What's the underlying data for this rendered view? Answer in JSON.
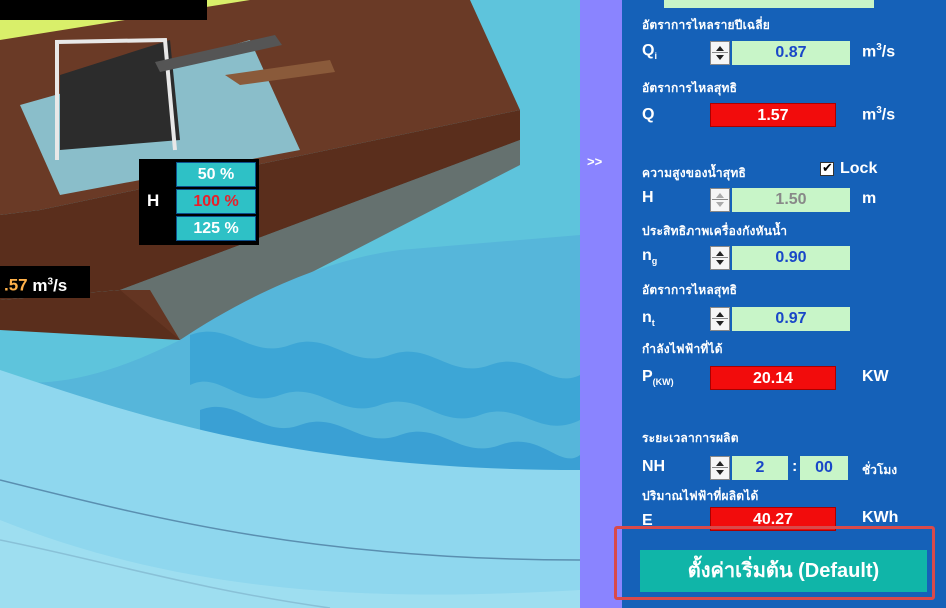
{
  "overlay": {
    "h_label": "H",
    "pct_options": [
      "50 %",
      "100 %",
      "125 %"
    ],
    "pct_selected": "100 %",
    "flow_value": ".57",
    "flow_unit": "m",
    "flow_unit_sup": "3",
    "flow_unit_tail": "/s"
  },
  "splitter": {
    "label": ">>"
  },
  "panel": {
    "avg_flow": {
      "title": "อัตราการไหลรายปีเฉลี่ย",
      "symbol": "Q",
      "sub": "i",
      "value": "0.87",
      "unit": "m",
      "unit_sup": "3",
      "unit_tail": "/s"
    },
    "net_flow": {
      "title": "อัตราการไหลสุทธิ",
      "symbol": "Q",
      "value": "1.57",
      "unit": "m",
      "unit_sup": "3",
      "unit_tail": "/s"
    },
    "net_head": {
      "title": "ความสูงของน้ำสุทธิ",
      "lock_label": "Lock",
      "lock_checked": true,
      "symbol": "H",
      "value": "1.50",
      "unit": "m"
    },
    "gen_eff": {
      "title": "ประสิทธิภาพเครื่องกังหันน้ำ",
      "symbol": "n",
      "sub": "g",
      "value": "0.90"
    },
    "turb_eff": {
      "title": "อัตราการไหลสุทธิ",
      "symbol": "n",
      "sub": "t",
      "value": "0.97"
    },
    "power": {
      "title": "กำลังไฟฟ้าที่ได้",
      "symbol": "P",
      "sub": "(KW)",
      "value": "20.14",
      "unit": "KW"
    },
    "hours": {
      "title": "ระยะเวลาการผลิต",
      "symbol": "NH",
      "hours_value": "2",
      "separator": ":",
      "minutes_value": "00",
      "unit": "ชั่วโมง"
    },
    "energy": {
      "title": "ปริมาณไฟฟ้าที่ผลิตได้",
      "symbol": "E",
      "value": "40.27",
      "unit": "KWh"
    },
    "default_button": "ตั้งค่าเริ่มต้น (Default)"
  },
  "colors": {
    "panel_bg": "#1561b8",
    "splitter": "#8a84ff",
    "value_green": "#c8f5c8",
    "value_red": "#f20c0c",
    "button": "#10b5a8",
    "highlight": "#d94a4a"
  }
}
